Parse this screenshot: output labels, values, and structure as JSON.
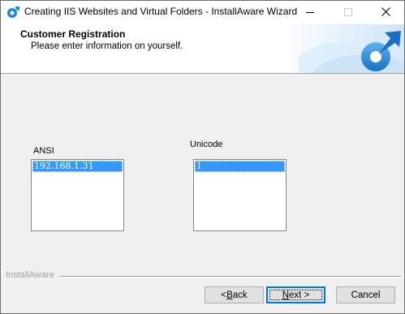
{
  "window": {
    "title": "Creating IIS Websites and Virtual Folders - InstallAware Wizard",
    "icon": "installaware-icon",
    "controls": [
      "minimize-icon",
      "maximize-icon",
      "close-icon"
    ]
  },
  "header": {
    "title": "Customer Registration",
    "subtitle": "Please enter information on yourself."
  },
  "main": {
    "ansi": {
      "label": "ANSI",
      "items": [
        "192.168.1.31"
      ]
    },
    "unicode": {
      "label": "Unicode",
      "items": [
        "1"
      ]
    }
  },
  "footer": {
    "brand": "InstallAware",
    "back_label_prefix": "<",
    "back_label_mnemonic": " B",
    "back_label_rest": "ack",
    "next_label_mnemonic": "N",
    "next_label_rest": "ext >",
    "cancel_label": "Cancel"
  },
  "colors": {
    "selection": "#3399ff",
    "accent": "#0078d7",
    "background": "#f0f0f0"
  }
}
